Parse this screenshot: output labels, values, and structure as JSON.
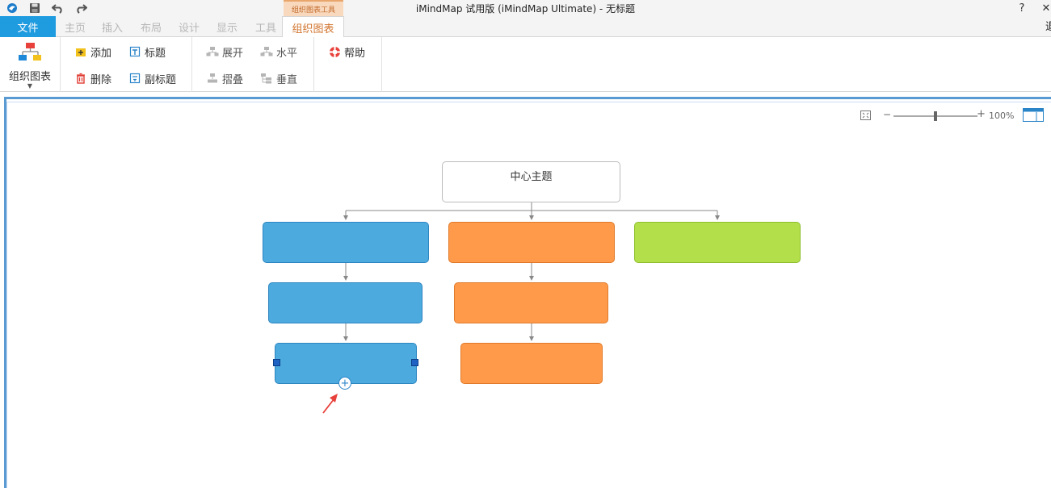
{
  "window": {
    "title": "iMindMap 试用版 (iMindMap Ultimate) - 无标题",
    "help_glyph": "?",
    "close_glyph": "✕",
    "edge_char": "退"
  },
  "quick_access": {
    "icons": [
      "app-logo-icon",
      "save-icon",
      "undo-icon",
      "redo-icon"
    ]
  },
  "tabs": {
    "file": "文件",
    "items": [
      "主页",
      "插入",
      "布局",
      "设计",
      "显示",
      "工具"
    ],
    "context_group": "组织图表工具",
    "active": "组织图表"
  },
  "ribbon": {
    "big_button": "组织图表",
    "add": "添加",
    "delete": "删除",
    "title": "标题",
    "subtitle": "副标题",
    "expand": "展开",
    "collapse": "摺叠",
    "horizontal": "水平",
    "vertical": "垂直",
    "help": "帮助"
  },
  "zoom": {
    "minus": "−",
    "plus": "+",
    "level": "100%",
    "slider_fraction": 0.5
  },
  "chart": {
    "center_topic": "中心主题",
    "add_child_glyph": "+"
  },
  "colors": {
    "blue": "#4caade",
    "blue_border": "#2e86c1",
    "orange": "#ff9a4a",
    "orange_border": "#e07a2a",
    "green": "#b3df4a",
    "green_border": "#8fbf2e",
    "file_tab": "#1f9be0",
    "connector": "#888888"
  }
}
